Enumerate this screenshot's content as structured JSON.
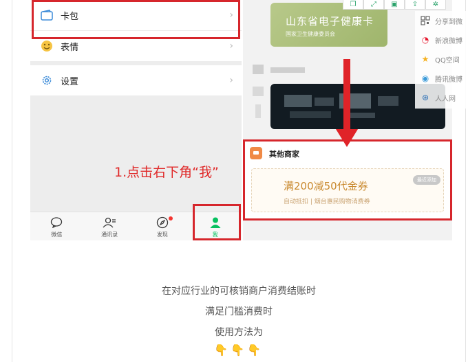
{
  "phone_left": {
    "menu": [
      {
        "label": "卡包",
        "icon": "card-wallet-icon"
      },
      {
        "label": "表情",
        "icon": "smiley-icon"
      },
      {
        "label": "设置",
        "icon": "settings-gear-icon"
      }
    ],
    "chevron": "›",
    "tabs": [
      {
        "label": "微信",
        "icon": "chat-bubble-icon"
      },
      {
        "label": "通讯录",
        "icon": "contacts-icon"
      },
      {
        "label": "发现",
        "icon": "compass-icon"
      },
      {
        "label": "我",
        "icon": "person-icon"
      }
    ],
    "annotation": "1.点击右下角“我”"
  },
  "phone_right": {
    "health_card": {
      "title": "山东省电子健康卡",
      "subtitle": "国家卫生健康委员会"
    },
    "merchant": {
      "title": "其他商家",
      "coupon": {
        "title": "满200减50代金券",
        "subtitle": "自动抵扣 | 烟台惠民购物消费券",
        "button": "最近添加"
      }
    }
  },
  "share": {
    "toolbar_icons": [
      "copy-icon",
      "expand-icon",
      "save-icon",
      "export-icon",
      "settings-icon"
    ],
    "items": [
      {
        "label": "分享到微",
        "icon": "qr-code-icon"
      },
      {
        "label": "新浪微博",
        "icon": "weibo-icon"
      },
      {
        "label": "QQ空间",
        "icon": "qzone-star-icon"
      },
      {
        "label": "腾讯微博",
        "icon": "tencent-weibo-icon"
      },
      {
        "label": "人人网",
        "icon": "renren-icon"
      }
    ]
  },
  "article": {
    "lines": [
      "在对应行业的可核销商户消费结账时",
      "满足门槛消费时",
      "使用方法为"
    ],
    "emoji": "👇👇👇"
  },
  "colors": {
    "highlight": "#d6262c",
    "wechat_green": "#07c160",
    "coupon_gold": "#c9892e"
  }
}
